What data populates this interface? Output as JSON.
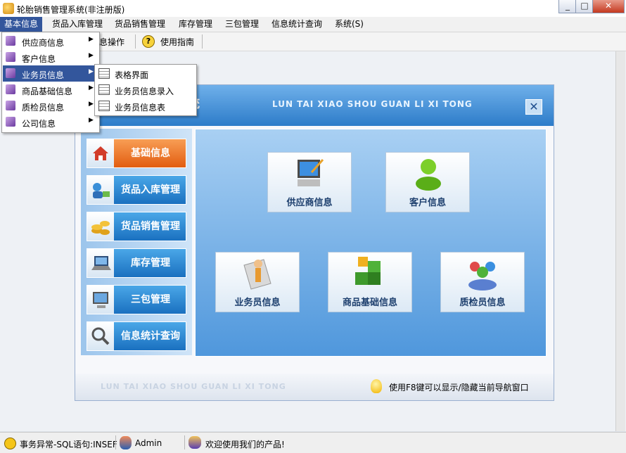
{
  "window": {
    "title": "轮胎销售管理系统(非注册版)"
  },
  "menubar": [
    "基本信息",
    "货品入库管理",
    "货品销售管理",
    "库存管理",
    "三包管理",
    "信息统计查询",
    "系统(S)"
  ],
  "toolbar": {
    "ops_label": "息操作",
    "help_label": "使用指南"
  },
  "dropdown": {
    "items": [
      "供应商信息",
      "客户信息",
      "业务员信息",
      "商品基础信息",
      "质检员信息",
      "公司信息"
    ]
  },
  "submenu": {
    "items": [
      "表格界面",
      "业务员信息录入",
      "业务员信息表"
    ]
  },
  "inner": {
    "banner_cn": "统",
    "banner_en": "LUN TAI XIAO SHOU GUAN LI XI TONG",
    "close_glyph": "✕",
    "nav": [
      "基础信息",
      "货品入库管理",
      "货品销售管理",
      "库存管理",
      "三包管理",
      "信息统计查询"
    ],
    "tiles": [
      "供应商信息",
      "客户信息",
      "业务员信息",
      "商品基础信息",
      "质检员信息"
    ],
    "footer_en": "LUN TAI XIAO SHOU GUAN LI XI TONG",
    "footer_tip": "使用F8键可以显示/隐藏当前导航窗口"
  },
  "statusbar": {
    "error": "事务异常-SQL语句:INSEF",
    "user": "Admin",
    "welcome": "欢迎使用我们的产品!"
  },
  "colors": {
    "menu_highlight": "#33569c",
    "nav_active": "#f07a2a",
    "nav_normal": "#2a86d6"
  }
}
